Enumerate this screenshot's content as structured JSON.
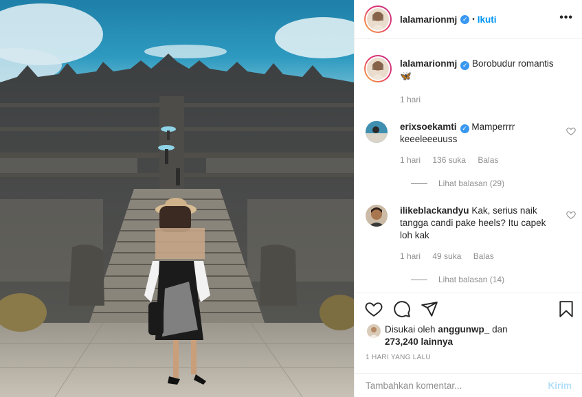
{
  "post": {
    "username": "lalamarionmj",
    "follow_label": "Ikuti",
    "dot": "•",
    "more_label": "•••",
    "caption": {
      "text": "Borobudur romantis",
      "emoji": "🦋",
      "time": "1 hari"
    }
  },
  "comments": [
    {
      "username": "erixsoekamti",
      "text": "Mamperrrr keeeleeeuuss",
      "time": "1 hari",
      "likes": "136 suka",
      "reply_label": "Balas",
      "view_replies": "Lihat balasan (29)"
    },
    {
      "username": "ilikeblackandyu",
      "text": "Kak, serius naik tangga candi pake heels? Itu capek loh kak",
      "time": "1 hari",
      "likes": "49 suka",
      "reply_label": "Balas",
      "view_replies": "Lihat balasan (14)"
    }
  ],
  "likes": {
    "prefix": "Disukai oleh",
    "liker": "anggunwp_",
    "conjunction": "dan",
    "others": "273,240 lainnya"
  },
  "timestamp": "1 HARI YANG LALU",
  "add_comment": {
    "placeholder": "Tambahkan komentar...",
    "post_label": "Kirim"
  },
  "icons": {
    "verified": "verified-badge-icon",
    "like": "heart-icon",
    "comment": "comment-icon",
    "share": "paper-plane-icon",
    "save": "bookmark-icon",
    "more": "more-options-icon"
  },
  "colors": {
    "link_blue": "#0095f6",
    "verified_blue": "#3897f0",
    "muted": "#8e8e8e",
    "text": "#262626",
    "post_disabled": "#b2dffc"
  }
}
